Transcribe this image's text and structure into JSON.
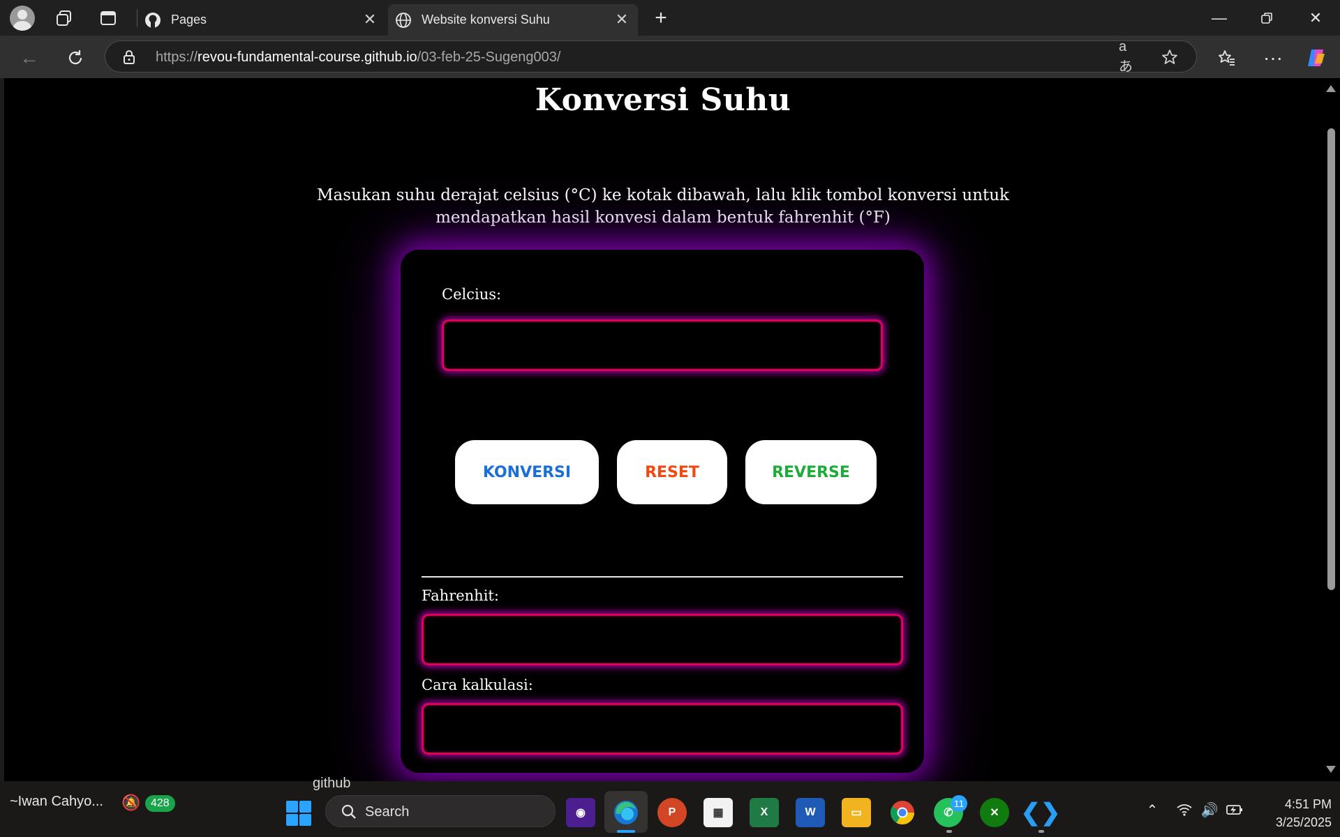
{
  "browser": {
    "tabs": [
      {
        "label": "Pages",
        "active": false,
        "icon": "github-icon"
      },
      {
        "label": "Website konversi Suhu",
        "active": true,
        "icon": "globe-icon"
      }
    ],
    "url_prefix": "https://",
    "url_host": "revou-fundamental-course.github.io",
    "url_path": "/03-feb-25-Sugeng003/"
  },
  "page": {
    "title": "Konversi Suhu",
    "description": "Masukan suhu derajat celsius (°C) ke kotak dibawah, lalu klik tombol konversi untuk mendapatkan hasil konvesi dalam bentuk fahrenhit (°F)",
    "celcius_label": "Celcius:",
    "celcius_value": "",
    "buttons": {
      "convert": "KONVERSI",
      "reset": "RESET",
      "reverse": "REVERSE"
    },
    "fahrenheit_label": "Fahrenhit:",
    "fahrenheit_value": "",
    "calc_label": "Cara kalkulasi:",
    "calc_value": "",
    "colors": {
      "convert": "#1a6fd8",
      "reset": "#f04a12",
      "reverse": "#1dac3a",
      "glow": "#8c00be",
      "field_border": "#e0005a"
    }
  },
  "taskbar": {
    "user": "~Iwan Cahyo...",
    "notification_count": "428",
    "behind_text": "github",
    "search_placeholder": "Search",
    "whatsapp_badge": "11",
    "time": "4:51 PM",
    "date": "3/25/2025"
  }
}
